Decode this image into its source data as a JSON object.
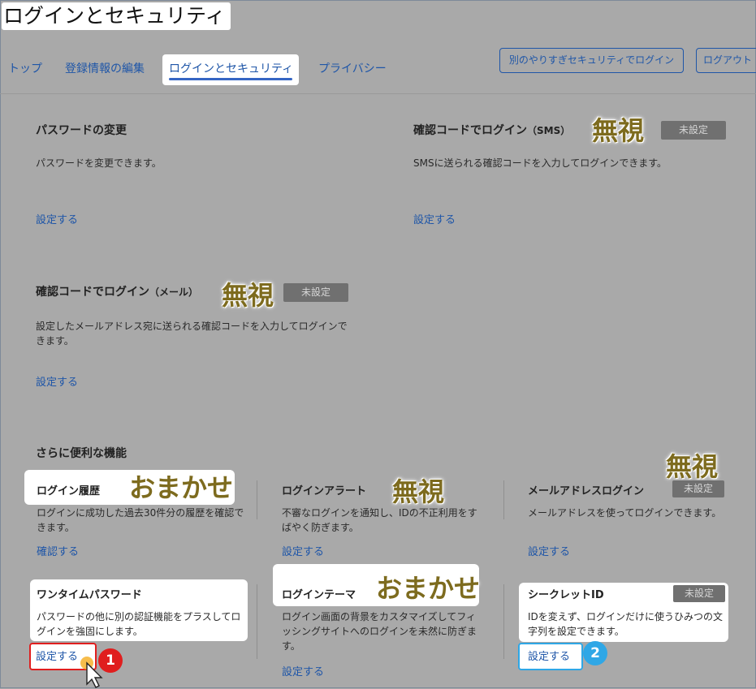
{
  "page_title": "ログインとセキュリティ",
  "tabs": [
    "トップ",
    "登録情報の編集",
    "ログインとセキュリティ",
    "プライバシー"
  ],
  "header_buttons": {
    "other_login": "別のやりすぎセキュリティでログイン",
    "logout": "ログアウト"
  },
  "badge_unset": "未設定",
  "notes": {
    "ignore": "無視",
    "auto": "おまかせ"
  },
  "cards": {
    "password": {
      "title": "パスワードの変更",
      "desc": "パスワードを変更できます。",
      "link": "設定する"
    },
    "sms": {
      "title": "確認コードでログイン",
      "title_suffix": "（SMS）",
      "desc": "SMSに送られる確認コードを入力してログインできます。",
      "link": "設定する"
    },
    "mail": {
      "title": "確認コードでログイン",
      "title_suffix": "（メール）",
      "desc": "設定したメールアドレス宛に送られる確認コードを入力してログインできます。",
      "link": "設定する"
    }
  },
  "features_heading": "さらに便利な機能",
  "features": {
    "history": {
      "title": "ログイン履歴",
      "desc": "ログインに成功した過去30件分の履歴を確認できます。",
      "link": "確認する"
    },
    "alert": {
      "title": "ログインアラート",
      "desc": "不審なログインを通知し、IDの不正利用をすばやく防ぎます。",
      "link": "設定する"
    },
    "email_login": {
      "title": "メールアドレスログイン",
      "desc": "メールアドレスを使ってログインできます。",
      "link": "設定する"
    },
    "onetime": {
      "title": "ワンタイムパスワード",
      "desc": "パスワードの他に別の認証機能をプラスしてログインを強固にします。",
      "link": "設定する"
    },
    "theme": {
      "title": "ログインテーマ",
      "desc": "ログイン画面の背景をカスタマイズしてフィッシングサイトへのログインを未然に防ぎます。",
      "link": "設定する"
    },
    "secret_id": {
      "title": "シークレットID",
      "desc": "IDを変えず、ログインだけに使うひみつの文字列を設定できます。",
      "link": "設定する"
    }
  },
  "markers": [
    "1",
    "2"
  ],
  "colors": {
    "link": "#1f56a8",
    "marker_red": "#e01e1e",
    "marker_blue": "#2fa7e6",
    "note": "#7d6b1e",
    "badge": "#707070"
  }
}
